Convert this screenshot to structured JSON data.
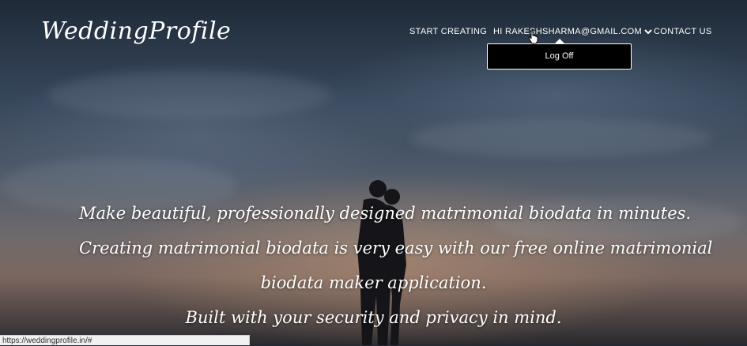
{
  "brand": {
    "logo_text": "WeddingProfile"
  },
  "nav": {
    "start_creating": "START CREATING",
    "user_greeting": "HI RAKESHSHARMA@GMAIL.COM",
    "contact_us": "CONTACT US"
  },
  "user_menu": {
    "log_off": "Log Off"
  },
  "hero": {
    "lines": [
      "Make beautiful, professionally designed matrimonial biodata in minutes.",
      "Creating matrimonial biodata is very easy with our free online matrimonial",
      "biodata maker application.",
      "Built with your security and privacy in mind."
    ]
  },
  "status_bar": {
    "url": "https://weddingprofile.in/#"
  },
  "icons": {
    "chevron": "chevron-down-icon",
    "cursor": "hand-pointer-icon"
  },
  "colors": {
    "text": "#ffffff",
    "dropdown_bg": "#000000"
  }
}
